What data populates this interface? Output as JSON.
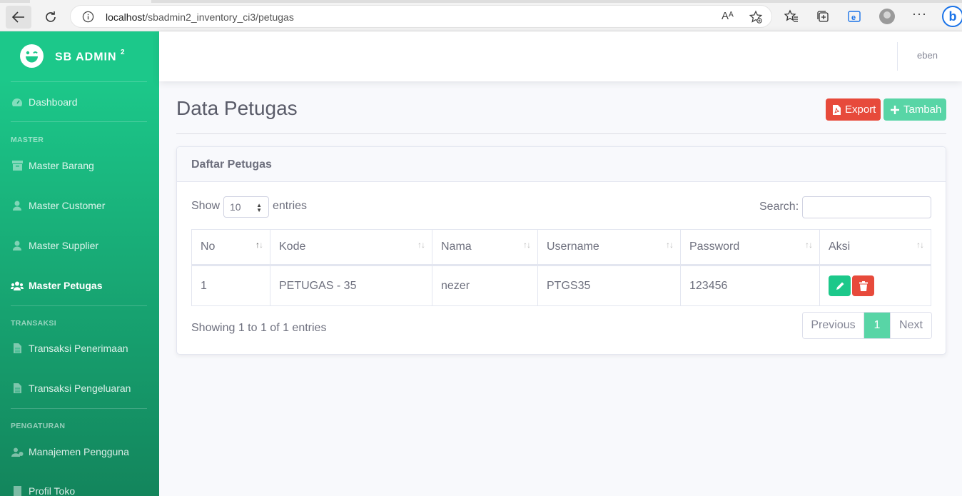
{
  "browser": {
    "url_host": "localhost",
    "url_path": "/sbadmin2_inventory_ci3/petugas",
    "read_aloud": "Aᴬ",
    "more": "···",
    "bing": "b"
  },
  "sidebar": {
    "brand": "SB ADMIN",
    "brand_sup": "2",
    "dashboard": "Dashboard",
    "heading_master": "MASTER",
    "master_barang": "Master Barang",
    "master_customer": "Master Customer",
    "master_supplier": "Master Supplier",
    "master_petugas": "Master Petugas",
    "heading_transaksi": "TRANSAKSI",
    "transaksi_penerimaan": "Transaksi Penerimaan",
    "transaksi_pengeluaran": "Transaksi Pengeluaran",
    "heading_pengaturan": "PENGATURAN",
    "manajemen_pengguna": "Manajemen Pengguna",
    "profil_toko": "Profil Toko"
  },
  "topbar": {
    "user": "eben"
  },
  "page": {
    "title": "Data Petugas",
    "export_label": "Export",
    "tambah_label": "Tambah"
  },
  "card": {
    "title": "Daftar Petugas",
    "show_label": "Show",
    "length_value": "10",
    "entries_label": "entries",
    "search_label": "Search:",
    "search_value": "",
    "columns": [
      "No",
      "Kode",
      "Nama",
      "Username",
      "Password",
      "Aksi"
    ],
    "rows": [
      {
        "no": "1",
        "kode": "PETUGAS - 35",
        "nama": "nezer",
        "username": "PTGS35",
        "password": "123456"
      }
    ],
    "info": "Showing 1 to 1 of 1 entries",
    "pagination": {
      "previous": "Previous",
      "current": "1",
      "next": "Next"
    }
  },
  "colors": {
    "sidebar_start": "#1cc88a",
    "sidebar_end": "#13855c",
    "danger": "#e74a3b",
    "success": "#1cc88a",
    "success_light": "#58d5a6"
  }
}
